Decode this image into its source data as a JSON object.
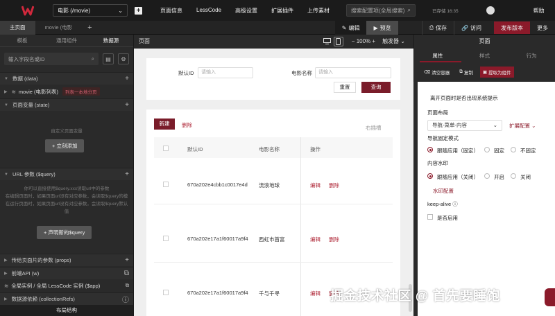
{
  "topbar": {
    "page_select": "电影 (/movie)",
    "menu": [
      "页面信息",
      "LessCode",
      "高级设置",
      "扩展插件",
      "上传素材"
    ],
    "search_placeholder": "搜索配置项(全局搜索)",
    "saved_text": "已存储 16:35",
    "help": "帮助"
  },
  "tabbar": {
    "tabs": [
      "主页面",
      "movie (电影"
    ],
    "edit": "编辑",
    "preview": "预览",
    "save": "保存",
    "visit": "访问",
    "publish": "发布版本",
    "more": "更多"
  },
  "left": {
    "tabs": [
      "模板",
      "通用组件",
      "数据源"
    ],
    "search_placeholder": "输入字段名或ID",
    "sections": {
      "data": "数据 (data)",
      "state": "页面变量 (state)",
      "query": "URL 参数 ($query)",
      "props": "传给页面片的参数 (props)",
      "api": "前端API (w)",
      "collections": "数据源依赖 (collectionRefs)"
    },
    "data_item": "movie (电影列表)",
    "data_item_tag": "列表一本地分页",
    "state_empty": "自定义页面变量",
    "state_btn": "+ 立刻添加",
    "query_empty_1": "你可以直接使用$query.xxx读取url中的参数",
    "query_empty_2": "在编辑页面时，如果页面url没有对应参数，会读取$query的模",
    "query_empty_3": "在运行页面时，如果页面url没有对应参数，会读取$query默认",
    "query_empty_4": "值",
    "query_btn": "+ 声明新的$query",
    "global": "全局实例 / 全局 LessCode 实例 ($app)",
    "footer": "布局结构"
  },
  "canvas": {
    "title": "页面",
    "zoom": "100%",
    "trigger": "触发器",
    "form": {
      "label1": "默认ID",
      "placeholder1": "请输入",
      "label2": "电影名称",
      "placeholder2": "请输入",
      "reset": "重置",
      "query": "查询"
    },
    "table": {
      "new": "新建",
      "delete": "删除",
      "right_hint": "右插槽",
      "headers": [
        "默认ID",
        "电影名称",
        "操作"
      ],
      "rows": [
        {
          "id": "670a202e4cbb1c0017e4d",
          "name": "流浪地球",
          "edit": "编辑",
          "del": "删除"
        },
        {
          "id": "670a202e17a1f60017a9f4",
          "name": "西虹市首富",
          "edit": "编辑",
          "del": "删除"
        },
        {
          "id": "670a202e17a1f60017a9f4",
          "name": "千与千寻",
          "edit": "编辑",
          "del": "删除"
        }
      ]
    }
  },
  "right": {
    "title": "页面",
    "tabs": [
      "属性",
      "样式",
      "行为"
    ],
    "tools": [
      "清空容器",
      "复制",
      "提取为组件"
    ],
    "leave_prompt": "离开页面时是否出现系统提示",
    "layout_label": "页面布局",
    "layout_value": "导航-菜单-内容",
    "layout_ext": "扩展配置",
    "nav_label": "导航固定模式",
    "nav_opts": [
      "跟随应用（固定）",
      "固定",
      "不固定"
    ],
    "wm_label": "内容水印",
    "wm_opts": [
      "跟随应用（关闭）",
      "开启",
      "关闭"
    ],
    "wm_config": "水印配置",
    "keepalive": "keep-alive",
    "enable": "是否启用"
  },
  "watermark": "掘金技术社区 @ 首先要睡饱"
}
